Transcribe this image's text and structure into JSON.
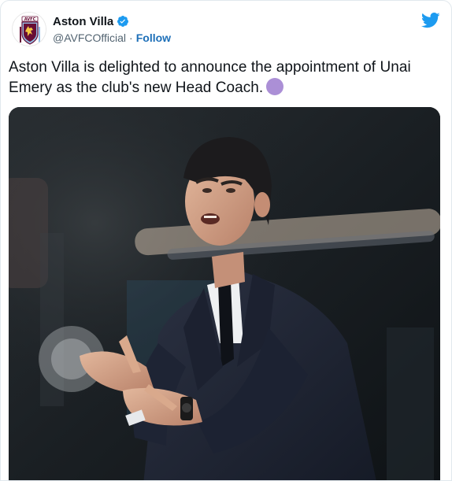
{
  "tweet": {
    "author": {
      "display_name": "Aston Villa",
      "handle": "@AVFCOfficial",
      "separator": "·",
      "follow_label": "Follow",
      "verified": true,
      "avatar_icon": "aston-villa-crest-icon",
      "avatar_crest_text": "AVFC"
    },
    "text": "Aston Villa is delighted to announce the appointment of Unai Emery as the club's new Head Coach.",
    "emoji": "purple-circle-emoji",
    "platform_icon": "twitter-bird-icon",
    "media": {
      "type": "photo",
      "description_icon": "coach-clapping-photo"
    }
  },
  "colors": {
    "twitter_blue": "#1d9bf0",
    "follow_link": "#1d6fb8",
    "verified_badge": "#1d9bf0",
    "emoji_purple": "#ab8fd6",
    "club_claret": "#670e36",
    "club_blue": "#95bfe5"
  }
}
